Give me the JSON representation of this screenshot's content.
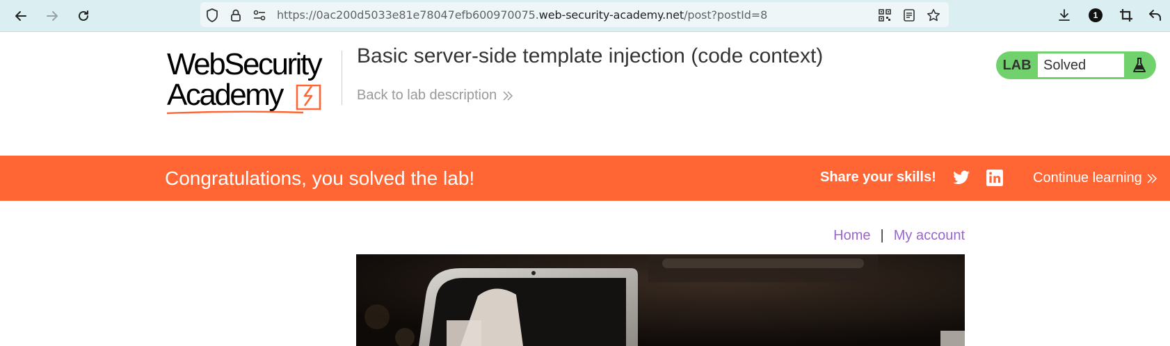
{
  "browser": {
    "url_prefix": "https://0ac200d5033e81e78047efb600970075.",
    "url_domain": "web-security-academy.net",
    "url_path": "/post?postId=8",
    "notification_count": "1",
    "icons": [
      "back-arrow-icon",
      "forward-arrow-icon",
      "reload-icon",
      "shield-icon",
      "lock-icon",
      "site-settings-icon",
      "qr-code-icon",
      "reader-view-icon",
      "star-icon",
      "download-icon",
      "crop-icon",
      "undo-icon"
    ]
  },
  "header": {
    "logo_line1": "WebSecurity",
    "logo_line2": "Academy",
    "lab_title": "Basic server-side template injection (code context)",
    "back_link": "Back to lab description",
    "lab_label": "LAB",
    "lab_status": "Solved",
    "colors": {
      "solved_green": "#70d16d",
      "accent_orange": "#ff6633"
    }
  },
  "banner": {
    "message": "Congratulations, you solved the lab!",
    "share_label": "Share your skills!",
    "continue_label": "Continue learning"
  },
  "nav": {
    "home": "Home",
    "separator": "|",
    "account": "My account",
    "link_color": "#9966cc"
  }
}
